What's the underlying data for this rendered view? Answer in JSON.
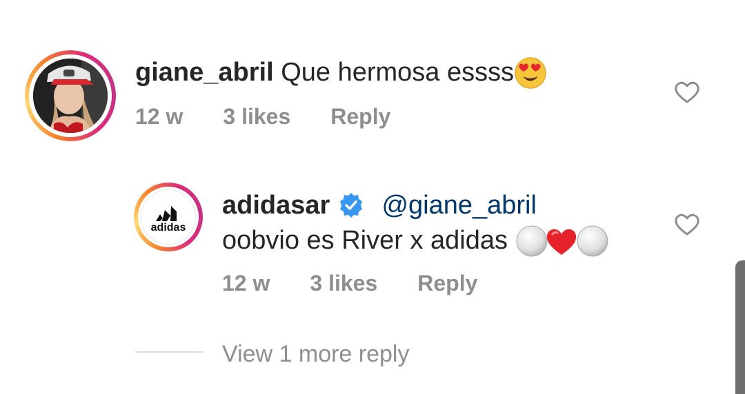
{
  "comments": [
    {
      "username": "giane_abril",
      "text": "Que hermosa essss",
      "emoji": "smiling-face-with-heart-eyes",
      "age": "12 w",
      "likes": "3 likes",
      "reply_label": "Reply"
    }
  ],
  "reply": {
    "username": "adidasar",
    "verified": true,
    "mention": "@giane_abril",
    "text": "oobvio es River x adidas",
    "emojis": [
      "white-circle",
      "red-heart",
      "white-circle"
    ],
    "logo_text": "adidas",
    "age": "12 w",
    "likes": "3 likes",
    "reply_label": "Reply"
  },
  "view_more": "View 1 more reply",
  "colors": {
    "username": "#262626",
    "meta": "#8e8e8e",
    "mention": "#00376b",
    "verified": "#3897f0"
  }
}
